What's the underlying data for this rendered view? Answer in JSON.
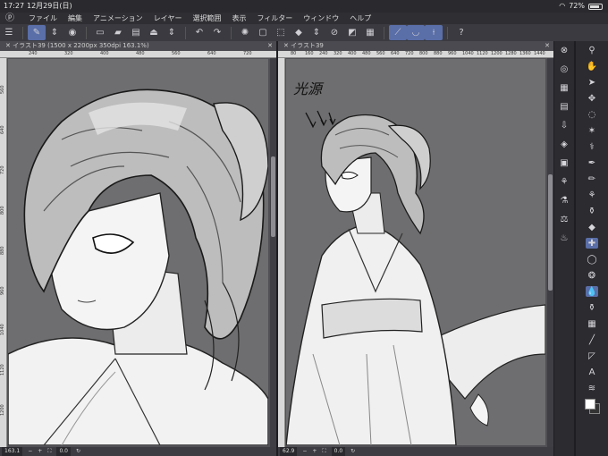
{
  "status": {
    "time": "17:27",
    "date": "12月29日(日)",
    "battery": "72%"
  },
  "menu": {
    "items": [
      "ファイル",
      "編集",
      "アニメーション",
      "レイヤー",
      "選択範囲",
      "表示",
      "フィルター",
      "ウィンドウ",
      "ヘルプ"
    ]
  },
  "toolbar": {
    "icons": [
      "menu-icon",
      "pen-tool-icon",
      "stepper-icon",
      "record-icon",
      "new-file-icon",
      "open-folder-icon",
      "save-icon",
      "export-icon",
      "stepper-icon",
      "undo-icon",
      "redo-icon",
      "loading-icon",
      "clear-icon",
      "transform-icon",
      "fill-icon",
      "stepper-icon",
      "select-icon",
      "invert-icon",
      "snap-ruler-icon",
      "snap-curve-icon",
      "snap-guide-icon",
      "help-icon"
    ]
  },
  "left_window": {
    "tab_title": "イラスト39 (1500 x 2200px 350dpi 163.1%)",
    "ruler_h": [
      "240",
      "320",
      "400",
      "480",
      "560",
      "640",
      "720"
    ],
    "ruler_v": [
      "560",
      "640",
      "720",
      "800",
      "880",
      "960",
      "1040",
      "1120",
      "1200"
    ],
    "zoom": "163.1",
    "rotation": "0.0"
  },
  "right_window": {
    "tab_title": "イラスト39",
    "ruler_h": [
      "80",
      "160",
      "240",
      "320",
      "400",
      "480",
      "560",
      "640",
      "720",
      "800",
      "880",
      "960",
      "1040",
      "1120",
      "1200",
      "1280",
      "1360",
      "1440"
    ],
    "annotation": "光源",
    "zoom": "62.9",
    "rotation": "0.0"
  },
  "palette1_icons": [
    "navigator-icon",
    "sub-view-icon",
    "layers-icon",
    "properties-icon",
    "material-icon",
    "history-icon",
    "layer-search-icon",
    "auto-action-icon",
    "color-wheel-icon",
    "color-set-icon",
    "intermediate-color-icon"
  ],
  "palette2_icons": [
    "zoom-icon",
    "hand-icon",
    "operation-icon",
    "move-layer-icon",
    "lasso-icon",
    "magic-wand-icon",
    "eyedropper-icon",
    "pen-icon",
    "pencil-icon",
    "brush-icon",
    "airbrush-icon",
    "decoration-icon",
    "eraser-icon",
    "blend-icon",
    "fill-icon",
    "gradient-icon",
    "figure-icon",
    "frame-icon",
    "text-icon",
    "balloon-icon",
    "correct-line-icon"
  ],
  "colors": {
    "accent": "#5a6ea8",
    "panel": "#2b2b30",
    "canvas_bg": "#6e6e70"
  }
}
